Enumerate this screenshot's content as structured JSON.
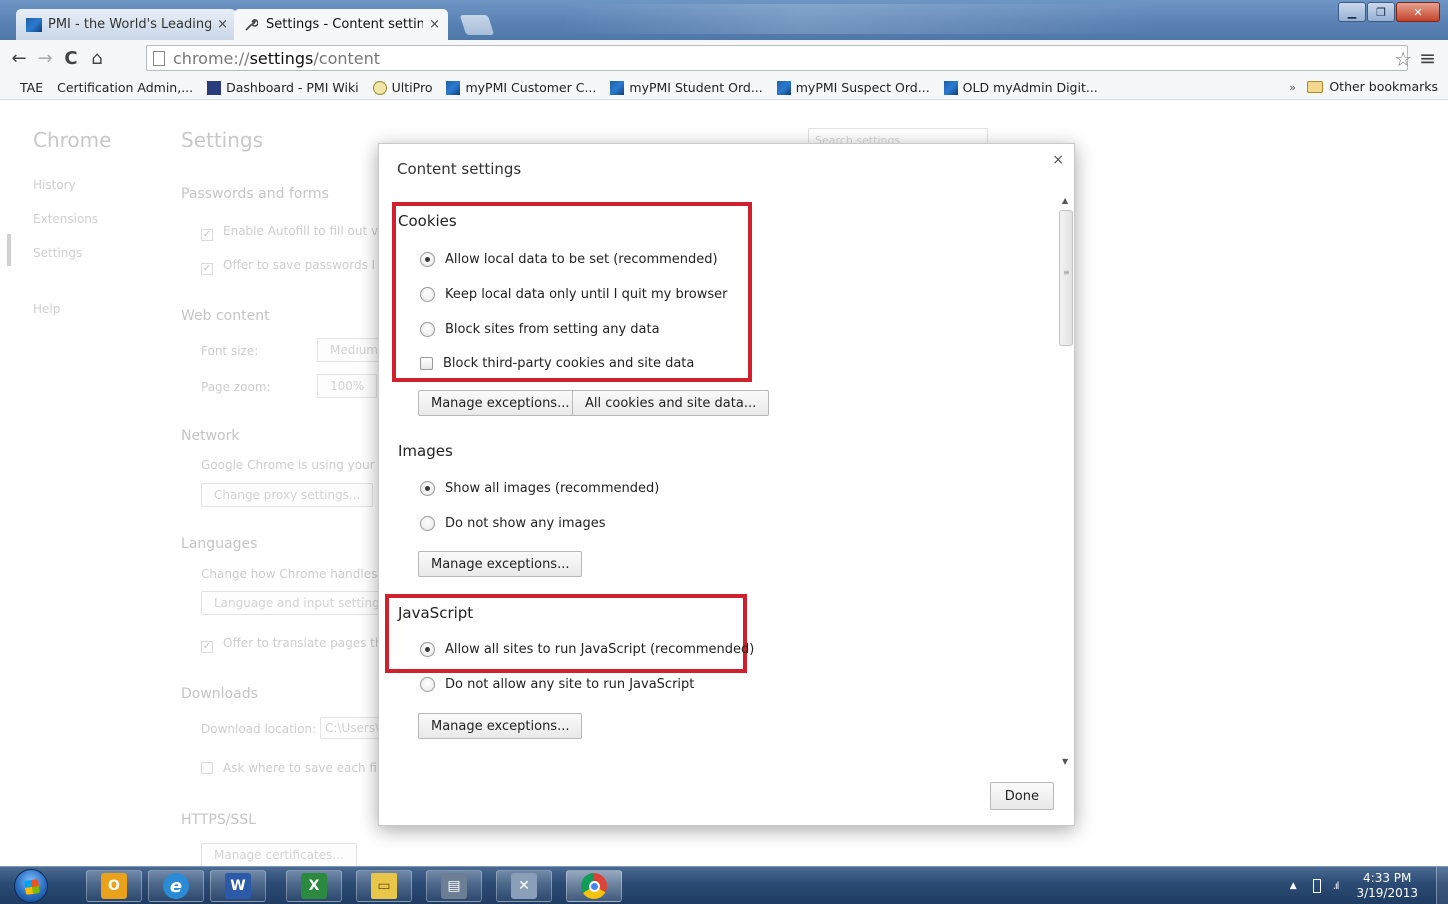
{
  "tabs": [
    {
      "title": "PMI - the World's Leading",
      "close": "×",
      "icon": "pmi-favicon"
    },
    {
      "title": "Settings - Content setting",
      "close": "×",
      "icon": "wrench-icon"
    }
  ],
  "toolbar": {
    "back": "←",
    "forward": "→",
    "reload": "C",
    "home": "⌂",
    "url_scheme": "chrome://",
    "url_host": "settings",
    "url_path": "/content",
    "star": "☆",
    "menu": "≡"
  },
  "bookmarks": {
    "items": [
      {
        "label": "TAE",
        "icon": "page-icon"
      },
      {
        "label": "Certification Admin,...",
        "icon": "page-icon"
      },
      {
        "label": "Dashboard - PMI Wiki",
        "icon": "wiki-icon"
      },
      {
        "label": "UltiPro",
        "icon": "ultipro-icon"
      },
      {
        "label": "myPMI Customer C...",
        "icon": "pmi-icon"
      },
      {
        "label": "myPMI Student Ord...",
        "icon": "pmi-icon"
      },
      {
        "label": "myPMI Suspect Ord...",
        "icon": "pmi-icon"
      },
      {
        "label": "OLD myAdmin Digit...",
        "icon": "pmi-icon"
      }
    ],
    "more": "»",
    "other": "Other bookmarks"
  },
  "settings_page": {
    "brand": "Chrome",
    "nav": [
      "History",
      "Extensions",
      "Settings",
      "Help"
    ],
    "title": "Settings",
    "search_placeholder": "Search settings",
    "passwords_header": "Passwords and forms",
    "autofill": "Enable Autofill to fill out v",
    "save_passwords": "Offer to save passwords I",
    "web_content_header": "Web content",
    "font_size_label": "Font size:",
    "font_size_value": "Medium",
    "page_zoom_label": "Page zoom:",
    "page_zoom_value": "100%",
    "network_header": "Network",
    "network_text": "Google Chrome is using your",
    "proxy_button": "Change proxy settings...",
    "languages_header": "Languages",
    "languages_text": "Change how Chrome handles",
    "language_button": "Language and input setting",
    "translate": "Offer to translate pages th",
    "downloads_header": "Downloads",
    "download_location_label": "Download location:",
    "download_location_value": "C:\\Users\\",
    "ask_where": "Ask where to save each fil",
    "https_header": "HTTPS/SSL",
    "certs_button": "Manage certificates..."
  },
  "dialog": {
    "title": "Content settings",
    "close": "×",
    "cookies": {
      "header": "Cookies",
      "options": [
        {
          "label": "Allow local data to be set (recommended)",
          "selected": true
        },
        {
          "label": "Keep local data only until I quit my browser",
          "selected": false
        },
        {
          "label": "Block sites from setting any data",
          "selected": false
        }
      ],
      "third_party": "Block third-party cookies and site data",
      "manage": "Manage exceptions...",
      "all_cookies": "All cookies and site data..."
    },
    "images": {
      "header": "Images",
      "options": [
        {
          "label": "Show all images (recommended)",
          "selected": true
        },
        {
          "label": "Do not show any images",
          "selected": false
        }
      ],
      "manage": "Manage exceptions..."
    },
    "javascript": {
      "header": "JavaScript",
      "options": [
        {
          "label": "Allow all sites to run JavaScript (recommended)",
          "selected": true
        },
        {
          "label": "Do not allow any site to run JavaScript",
          "selected": false
        }
      ],
      "manage": "Manage exceptions..."
    },
    "done": "Done",
    "highlight_color": "#d0202e"
  },
  "taskbar": {
    "apps": [
      "outlook-icon",
      "ie-icon",
      "word-icon",
      "excel-icon",
      "explorer-icon",
      "scanner-icon",
      "tools-icon",
      "chrome-icon"
    ],
    "time": "4:33 PM",
    "date": "3/19/2013"
  }
}
